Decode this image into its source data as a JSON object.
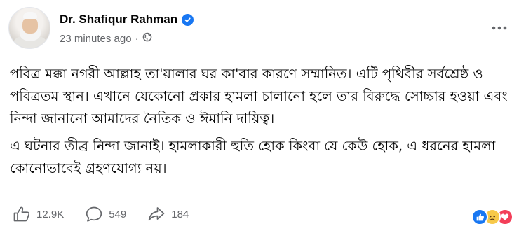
{
  "author": {
    "name": "Dr. Shafiqur Rahman",
    "verified": true
  },
  "post_meta": {
    "timestamp": "23 minutes ago",
    "separator": "·",
    "audience_icon": "globe-icon"
  },
  "content": {
    "paragraphs": [
      "পবিত্র মক্কা নগরী আল্লাহ তা'য়ালার ঘর কা'বার কারণে সম্মানিত। এটি পৃথিবীর সর্বশ্রেষ্ঠ ও পবিত্রতম স্থান। এখানে যেকোনো প্রকার হামলা চালানো হলে তার বিরুদ্ধে সোচ্চার হওয়া এবং নিন্দা জানানো আমাদের নৈতিক ও ঈমানি দায়িত্ব।",
      "এ ঘটনার তীব্র নিন্দা জানাই। হামলাকারী হুতি হোক কিংবা যে কেউ হোক, এ ধরনের হামলা কোনোভাবেই গ্রহণযোগ্য নয়।"
    ]
  },
  "stats": {
    "likes": "12.9K",
    "comments": "549",
    "shares": "184"
  },
  "reactions": [
    "like",
    "sad",
    "love"
  ],
  "colors": {
    "accent": "#1877f2",
    "secondary_text": "#65676b",
    "love": "#f33e58",
    "sad": "#f7c94a"
  }
}
